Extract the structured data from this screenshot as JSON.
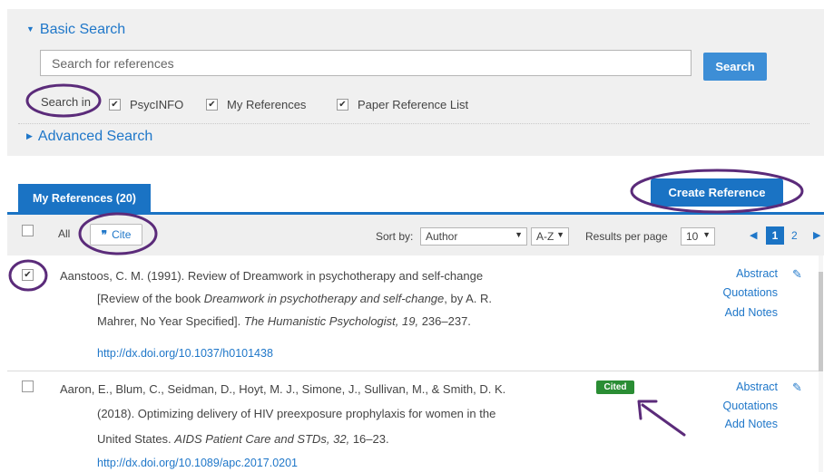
{
  "search": {
    "basic_label": "Basic Search",
    "placeholder": "Search for references",
    "button_label": "Search",
    "search_in_label": "Search in",
    "sources": [
      {
        "label": "PsycINFO",
        "checked": true
      },
      {
        "label": "My References",
        "checked": true
      },
      {
        "label": "Paper Reference List",
        "checked": true
      }
    ],
    "advanced_label": "Advanced Search"
  },
  "tabs": {
    "my_references": "My References (20)"
  },
  "actions": {
    "create_reference": "Create Reference"
  },
  "toolbar": {
    "all_label": "All",
    "cite_label": "Cite",
    "cite_icon": "quote-icon",
    "sort_by_label": "Sort by:",
    "sort_value": "Author",
    "order_value": "A-Z",
    "results_per_page_label": "Results per page",
    "results_per_page_value": "10",
    "current_page": "1",
    "next_page": "2"
  },
  "references": [
    {
      "checked": true,
      "line1": "Aanstoos, C. M. (1991). Review of Dreamwork in psychotherapy and self-change",
      "line2_pre": "[Review of the book ",
      "line2_title": "Dreamwork in psychotherapy and self-change",
      "line2_post": ", by A. R.",
      "line3_pre": "Mahrer, No Year Specified]. ",
      "line3_journal": "The Humanistic Psychologist, 19,",
      "line3_post": " 236–237.",
      "doi": "http://dx.doi.org/10.1037/h0101438",
      "cited": false,
      "abstract_label": "Abstract",
      "quotations_label": "Quotations",
      "notes_label": "Add Notes"
    },
    {
      "checked": false,
      "line1": "Aaron, E., Blum, C., Seidman, D., Hoyt, M. J., Simone, J., Sullivan, M., & Smith, D. K.",
      "line2": "(2018). Optimizing delivery of HIV preexposure prophylaxis for women in the",
      "line3_pre": "United States. ",
      "line3_journal": "AIDS Patient Care and STDs, 32,",
      "line3_post": " 16–23.",
      "doi": "http://dx.doi.org/10.1089/apc.2017.0201",
      "cited": true,
      "cited_label": "Cited",
      "abstract_label": "Abstract",
      "quotations_label": "Quotations",
      "notes_label": "Add Notes"
    }
  ],
  "colors": {
    "accent": "#1a73c4",
    "link": "#1f77c9",
    "cited_badge": "#2a8d34",
    "annotation": "#5b2b7a",
    "panel_bg": "#f0f0f0"
  }
}
